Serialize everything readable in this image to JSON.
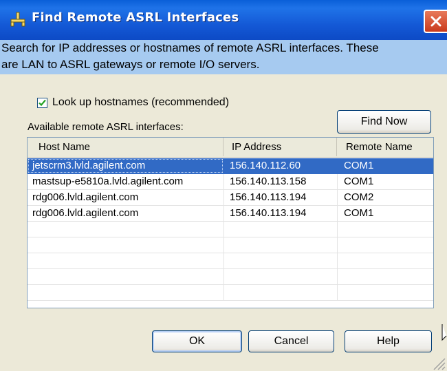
{
  "window": {
    "title": "Find Remote ASRL Interfaces",
    "icon": "network-connector-icon",
    "close_icon": "close-icon"
  },
  "description": {
    "line1": "Search for IP addresses or hostnames of remote ASRL interfaces.  These",
    "line2": "are LAN to ASRL gateways or remote I/O servers."
  },
  "lookup_checkbox": {
    "label": "Look up hostnames (recommended)",
    "checked": true
  },
  "list": {
    "label": "Available remote ASRL interfaces:",
    "columns": [
      "Host Name",
      "IP Address",
      "Remote Name"
    ],
    "rows": [
      {
        "host": "jetscrm3.lvld.agilent.com",
        "ip": "156.140.112.60",
        "remote": "COM1",
        "selected": true
      },
      {
        "host": "mastsup-e5810a.lvld.agilent.com",
        "ip": "156.140.113.158",
        "remote": "COM1",
        "selected": false
      },
      {
        "host": "rdg006.lvld.agilent.com",
        "ip": "156.140.113.194",
        "remote": "COM2",
        "selected": false
      },
      {
        "host": "rdg006.lvld.agilent.com",
        "ip": "156.140.113.194",
        "remote": "COM1",
        "selected": false
      }
    ],
    "empty_rows": 5
  },
  "buttons": {
    "find_now": "Find Now",
    "ok": "OK",
    "cancel": "Cancel",
    "help": "Help"
  },
  "colors": {
    "titlebar": "#1459d6",
    "description_bg": "#a6caf0",
    "selection": "#316ac5",
    "dialog_bg": "#ece9d8"
  }
}
